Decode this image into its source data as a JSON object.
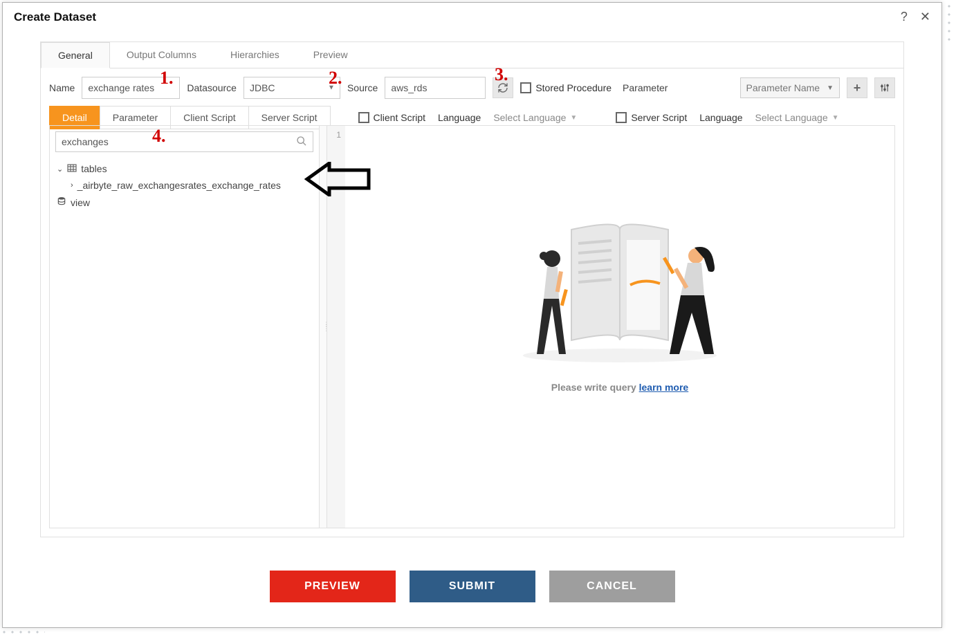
{
  "title": "Create Dataset",
  "tabs": [
    "General",
    "Output Columns",
    "Hierarchies",
    "Preview"
  ],
  "form": {
    "name_label": "Name",
    "name_value": "exchange rates",
    "datasource_label": "Datasource",
    "datasource_value": "JDBC",
    "source_label": "Source",
    "source_value": "aws_rds",
    "stored_proc_label": "Stored Procedure",
    "parameter_label": "Parameter",
    "parameter_select": "Parameter Name"
  },
  "sub_tabs": [
    "Detail",
    "Parameter",
    "Client Script",
    "Server Script"
  ],
  "scripts": {
    "client_label": "Client Script",
    "server_label": "Server Script",
    "language_label": "Language",
    "language_placeholder": "Select Language"
  },
  "search": {
    "value": "exchanges"
  },
  "tree": {
    "tables_label": "tables",
    "table_item": "_airbyte_raw_exchangesrates_exchange_rates",
    "view_label": "view"
  },
  "editor": {
    "line1": "1",
    "placeholder_prefix": "Please write query ",
    "placeholder_link": "learn more"
  },
  "buttons": {
    "preview": "PREVIEW",
    "submit": "SUBMIT",
    "cancel": "CANCEL"
  },
  "annotations": {
    "a1": "1.",
    "a2": "2.",
    "a3": "3.",
    "a4": "4."
  }
}
